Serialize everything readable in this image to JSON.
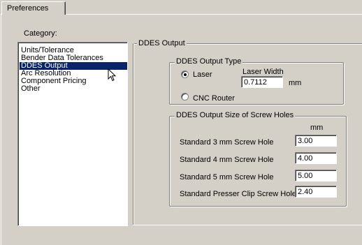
{
  "tab": {
    "label": "Preferences"
  },
  "category": {
    "label": "Category:",
    "items": [
      {
        "label": "Units/Tolerance",
        "selected": false
      },
      {
        "label": "Bender Data Tolerances",
        "selected": false
      },
      {
        "label": "DDES Output",
        "selected": true
      },
      {
        "label": "Arc Resolution",
        "selected": false
      },
      {
        "label": "Component Pricing",
        "selected": false
      },
      {
        "label": "Other",
        "selected": false
      }
    ]
  },
  "pane": {
    "title": "DDES Output",
    "output_type": {
      "title": "DDES Output Type",
      "laser_label": "Laser",
      "laser_checked": true,
      "cnc_label": "CNC Router",
      "cnc_checked": false,
      "laser_width_label": "Laser Width",
      "laser_width_value": "0.7112",
      "laser_width_unit": "mm"
    },
    "screw_holes": {
      "title": "DDES Output Size of Screw Holes",
      "unit": "mm",
      "rows": [
        {
          "label": "Standard 3 mm Screw Hole",
          "value": "3.00"
        },
        {
          "label": "Standard 4 mm Screw Hole",
          "value": "4.00"
        },
        {
          "label": "Standard 5 mm Screw Hole",
          "value": "5.00"
        },
        {
          "label": "Standard Presser Clip Screw Hole",
          "value": "2.40"
        }
      ]
    }
  },
  "colors": {
    "face": "#d4d0c8",
    "selection": "#0a246a",
    "shadow": "#808080"
  },
  "icons": {
    "cursor": "arrow-cursor-icon"
  }
}
